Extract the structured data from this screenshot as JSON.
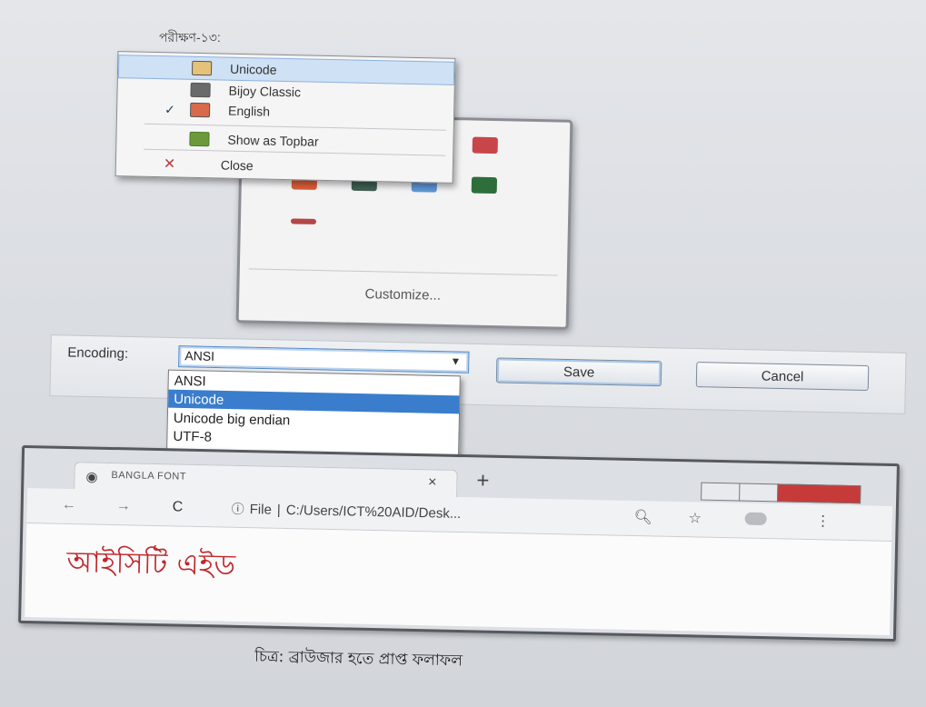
{
  "step_label": "পরীক্ষণ-১৩:",
  "tray": {
    "icons": [
      {
        "name": "app-icon-1",
        "color": "#8a5a3a"
      },
      {
        "name": "app-icon-2",
        "color": "#d0923a"
      },
      {
        "name": "app-icon-3",
        "color": "#5c7a3c"
      },
      {
        "name": "app-icon-4",
        "color": "#c8464a"
      },
      {
        "name": "app-icon-5",
        "color": "#d95b37"
      },
      {
        "name": "app-icon-6",
        "color": "#3f5f52"
      },
      {
        "name": "app-icon-7",
        "color": "#5f98d8"
      },
      {
        "name": "app-icon-8",
        "color": "#2e6e3a"
      },
      {
        "name": "app-icon-9",
        "color": "#b54646"
      }
    ],
    "customize_label": "Customize..."
  },
  "context_menu": {
    "items": [
      {
        "label": "Unicode",
        "highlighted": true
      },
      {
        "label": "Bijoy Classic"
      },
      {
        "label": "English",
        "checked": true
      },
      {
        "label": "Show as Topbar"
      },
      {
        "label": "Close"
      }
    ],
    "check_mark": "✓"
  },
  "save_dialog": {
    "encoding_label": "Encoding:",
    "encoding_value": "ANSI",
    "save_label": "Save",
    "cancel_label": "Cancel",
    "encoding_options": [
      "ANSI",
      "Unicode",
      "Unicode big endian",
      "UTF-8"
    ],
    "selected_option": "Unicode"
  },
  "browser": {
    "tab_title": "BANGLA FONT",
    "tab_close": "×",
    "new_tab": "+",
    "back": "←",
    "forward": "→",
    "reload": "C",
    "info_icon": "ⓘ",
    "address_prefix": "File",
    "address_sep": "|",
    "address": "C:/Users/ICT%20AID/Desk...",
    "search_icon": "🔍︎",
    "star_icon": "☆",
    "menu_icon": "⋮",
    "page_text": "আইসিটি এইড"
  },
  "caption": "চিত্র: ব্রাউজার হতে প্রাপ্ত ফলাফল",
  "colors": {
    "bangla_text": "#c0282c",
    "selected_option": "#3a7dcc",
    "window_close": "#c73a3a"
  }
}
